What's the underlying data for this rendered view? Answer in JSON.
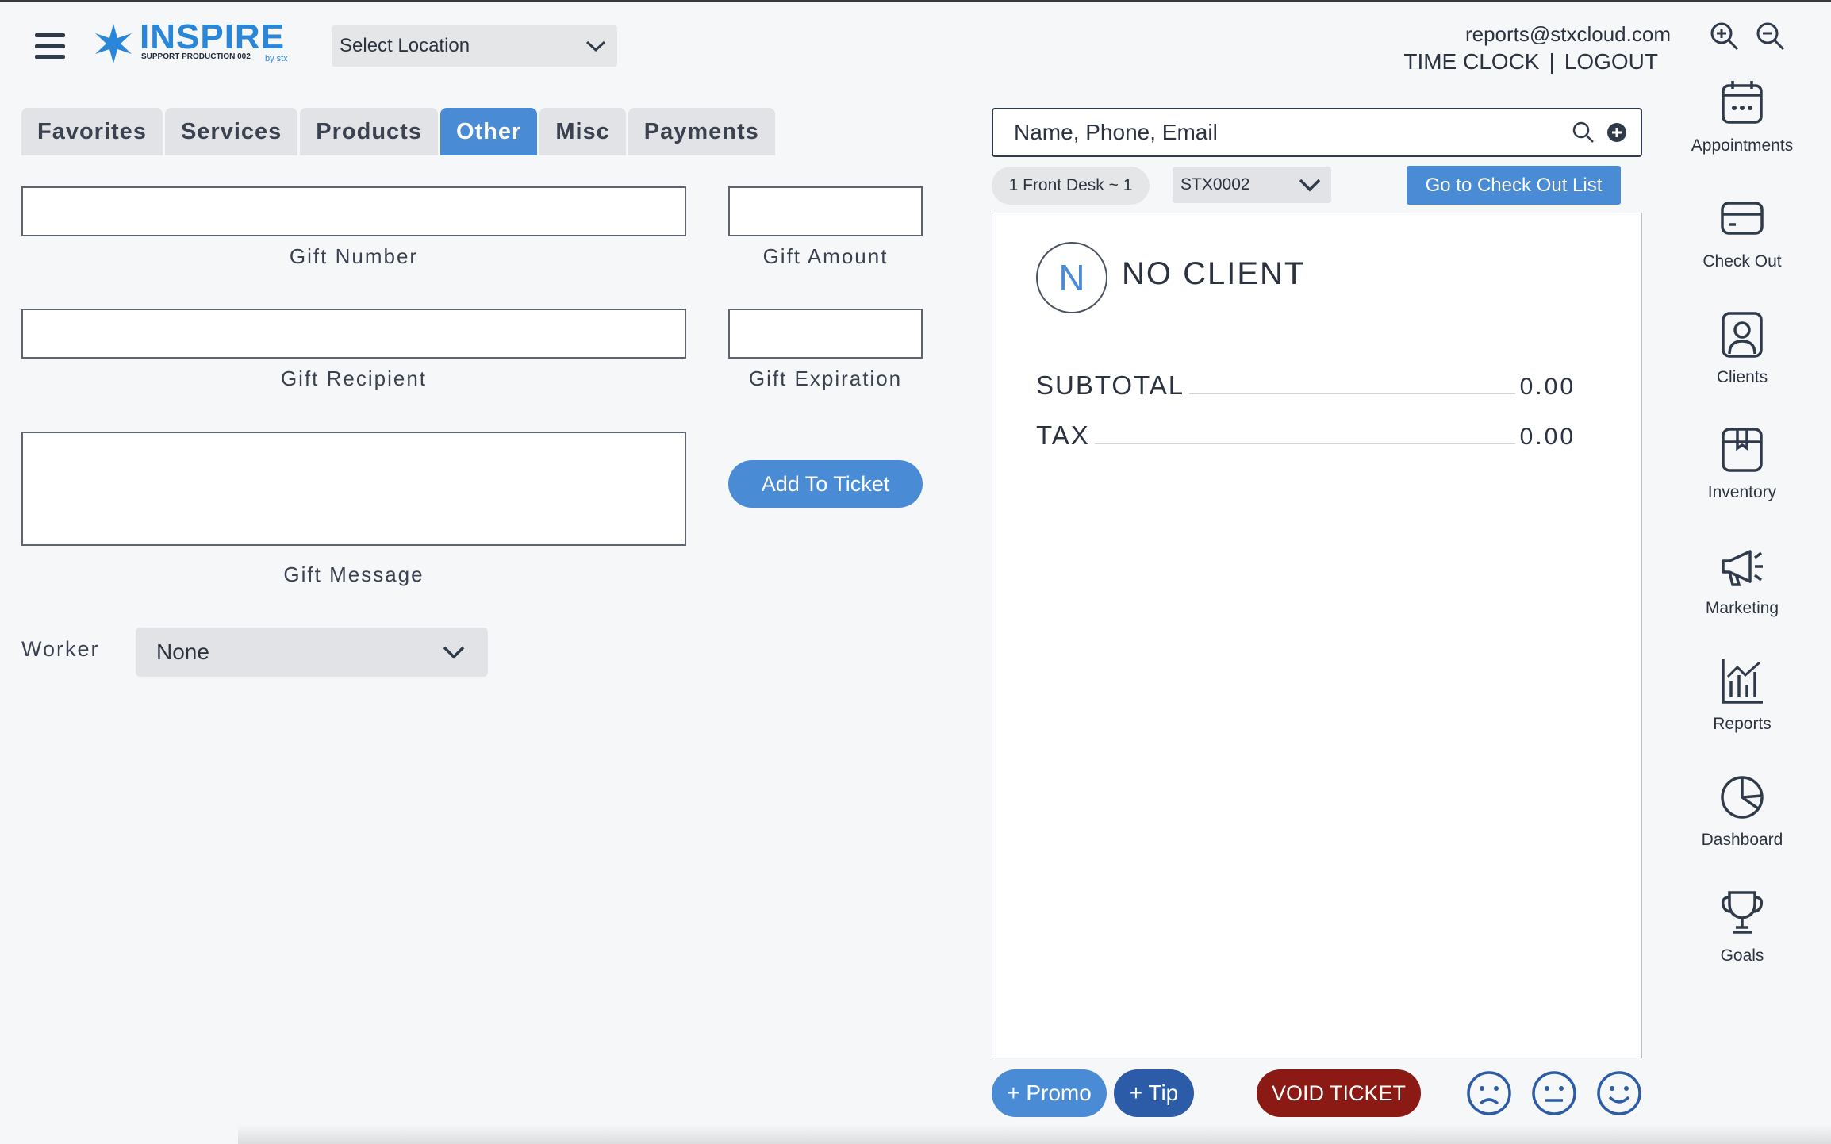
{
  "header": {
    "logo_name": "INSPIRE",
    "logo_sub": "SUPPORT PRODUCTION 002",
    "logo_by": "by stx",
    "location_select": "Select Location",
    "user_email": "reports@stxcloud.com",
    "time_clock": "TIME CLOCK",
    "separator": "|",
    "logout": "LOGOUT"
  },
  "tabs": [
    {
      "label": "Favorites",
      "active": false
    },
    {
      "label": "Services",
      "active": false
    },
    {
      "label": "Products",
      "active": false
    },
    {
      "label": "Other",
      "active": true
    },
    {
      "label": "Misc",
      "active": false
    },
    {
      "label": "Payments",
      "active": false
    }
  ],
  "form": {
    "gift_number_label": "Gift Number",
    "gift_amount_label": "Gift Amount",
    "gift_recipient_label": "Gift Recipient",
    "gift_expiration_label": "Gift Expiration",
    "gift_message_label": "Gift Message",
    "add_to_ticket": "Add To Ticket",
    "worker_label": "Worker",
    "worker_value": "None",
    "gift_number_value": "",
    "gift_amount_value": "",
    "gift_recipient_value": "",
    "gift_expiration_value": "",
    "gift_message_value": ""
  },
  "ticket": {
    "search_placeholder": "Name, Phone, Email",
    "desk": "1 Front Desk ~ 1",
    "register": "STX0002",
    "checkout_list": "Go to Check Out List",
    "client_initial": "N",
    "client_name": "NO CLIENT",
    "subtotal_label": "SUBTOTAL",
    "subtotal_value": "0.00",
    "tax_label": "TAX",
    "tax_value": "0.00",
    "promo": "+ Promo",
    "tip": "+ Tip",
    "void": "VOID TICKET"
  },
  "nav": [
    {
      "label": "Appointments",
      "icon": "calendar-icon"
    },
    {
      "label": "Check Out",
      "icon": "credit-card-icon"
    },
    {
      "label": "Clients",
      "icon": "person-icon"
    },
    {
      "label": "Inventory",
      "icon": "box-icon"
    },
    {
      "label": "Marketing",
      "icon": "megaphone-icon"
    },
    {
      "label": "Reports",
      "icon": "bar-chart-icon"
    },
    {
      "label": "Dashboard",
      "icon": "pie-chart-icon"
    },
    {
      "label": "Goals",
      "icon": "trophy-icon"
    }
  ],
  "colors": {
    "accent": "#4a8bd6",
    "tip": "#2c5ba8",
    "void": "#8b1a14",
    "text": "#2c3340"
  }
}
